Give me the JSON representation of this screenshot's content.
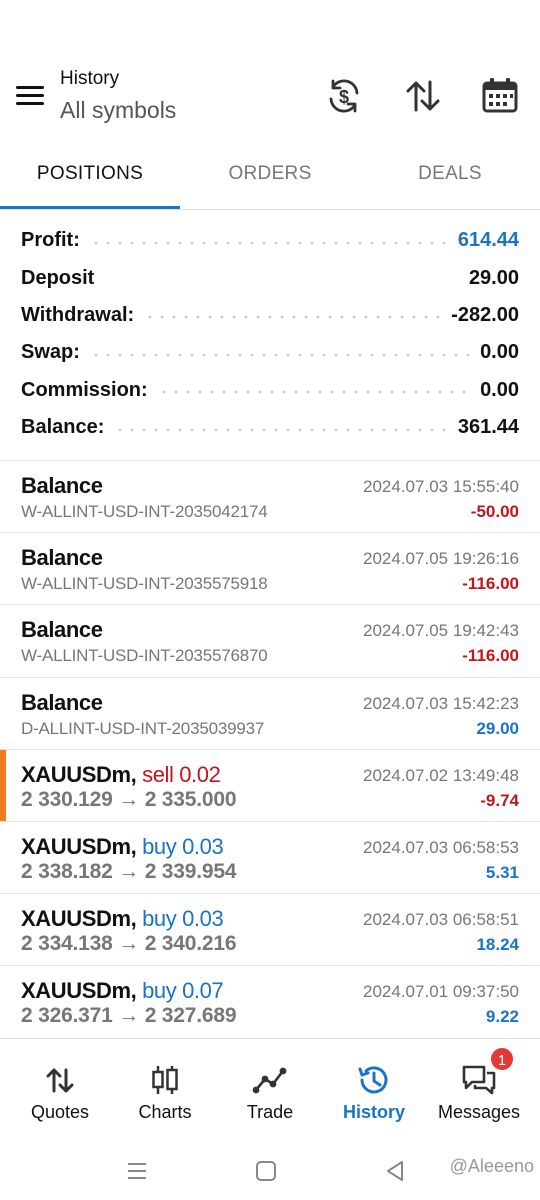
{
  "header": {
    "title": "History",
    "subtitle": "All symbols",
    "icons": [
      "currency-sync-icon",
      "sort-icon",
      "calendar-icon"
    ]
  },
  "tabs": [
    {
      "label": "POSITIONS",
      "active": true
    },
    {
      "label": "ORDERS",
      "active": false
    },
    {
      "label": "DEALS",
      "active": false
    }
  ],
  "summary": [
    {
      "label": "Profit:",
      "value": "614.44",
      "color": "#1a73c9"
    },
    {
      "label": "Deposit",
      "value": "29.00"
    },
    {
      "label": "Withdrawal:",
      "value": "-282.00"
    },
    {
      "label": "Swap:",
      "value": "0.00"
    },
    {
      "label": "Commission:",
      "value": "0.00"
    },
    {
      "label": "Balance:",
      "value": "361.44"
    }
  ],
  "items": [
    {
      "title": "Balance",
      "sub": "W-ALLINT-USD-INT-2035042174",
      "time": "2024.07.03 15:55:40",
      "amount": "-50.00"
    },
    {
      "title": "Balance",
      "sub": "W-ALLINT-USD-INT-2035575918",
      "time": "2024.07.05 19:26:16",
      "amount": "-116.00"
    },
    {
      "title": "Balance",
      "sub": "W-ALLINT-USD-INT-2035576870",
      "time": "2024.07.05 19:42:43",
      "amount": "-116.00"
    },
    {
      "title": "Balance",
      "sub": "D-ALLINT-USD-INT-2035039937",
      "time": "2024.07.03 15:42:23",
      "amount": "29.00"
    },
    {
      "symbol": "XAUUSDm,",
      "type": "sell 0.02",
      "prices": "2 330.129 → 2 335.000",
      "time": "2024.07.02 13:49:48",
      "amount": "-9.74"
    },
    {
      "symbol": "XAUUSDm,",
      "type": "buy 0.03",
      "prices": "2 338.182 → 2 339.954",
      "time": "2024.07.03 06:58:53",
      "amount": "5.31"
    },
    {
      "symbol": "XAUUSDm,",
      "type": "buy 0.03",
      "prices": "2 334.138 → 2 340.216",
      "time": "2024.07.03 06:58:51",
      "amount": "18.24"
    },
    {
      "symbol": "XAUUSDm,",
      "type": "buy 0.07",
      "prices": "2 326.371 → 2 327.689",
      "time": "2024.07.01 09:37:50",
      "amount": "9.22"
    }
  ],
  "bottom_nav": [
    {
      "label": "Quotes",
      "icon": "quotes-icon"
    },
    {
      "label": "Charts",
      "icon": "charts-icon"
    },
    {
      "label": "Trade",
      "icon": "trade-icon"
    },
    {
      "label": "History",
      "icon": "history-icon",
      "active": true
    },
    {
      "label": "Messages",
      "icon": "messages-icon",
      "badge": "1"
    }
  ],
  "watermark": "@Aleeeno",
  "colors": {
    "accent": "#1a73c9",
    "negative": "#c0161c",
    "sell_marker": "#f07c1e",
    "badge": "#e53935"
  }
}
